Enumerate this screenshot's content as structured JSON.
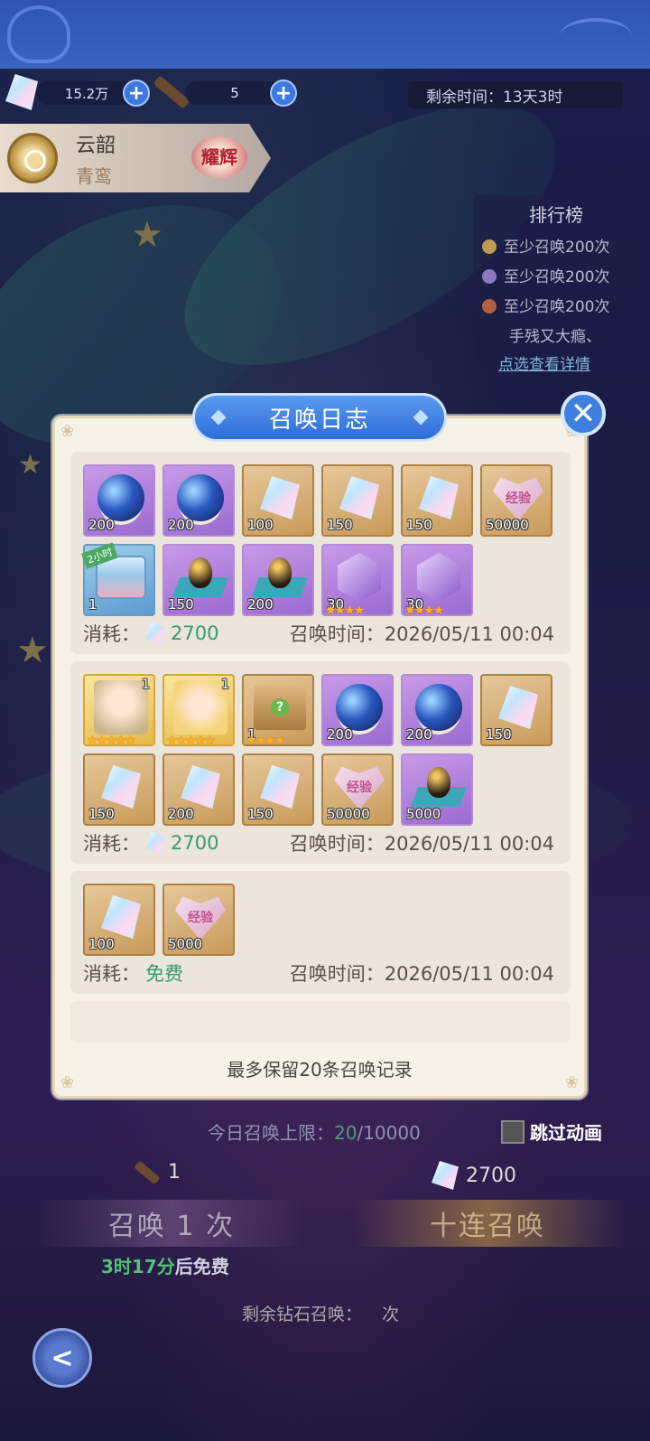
{
  "resources": {
    "crystal_amount": "15.2万",
    "scroll_amount": "5"
  },
  "event": {
    "remaining_time": "剩余时间：13天3时",
    "banner_name": "云韶",
    "banner_sub": "青鸾",
    "banner_badge": "耀辉"
  },
  "ranking": {
    "title": "排行榜",
    "entries": [
      "至少召唤200次",
      "至少召唤200次",
      "至少召唤200次"
    ],
    "tip": "手残又大瘾、",
    "link": "点选查看详情"
  },
  "modal": {
    "title": "召唤日志",
    "close": "✕",
    "note": "最多保留20条召唤记录",
    "cost_label": "消耗：",
    "time_label": "召唤时间：",
    "records": [
      {
        "cost": "2700",
        "time": "2026/05/11 00:04",
        "items": [
          {
            "type": "orb",
            "qty": "200"
          },
          {
            "type": "orb",
            "qty": "200"
          },
          {
            "type": "gem",
            "qty": "100"
          },
          {
            "type": "gem",
            "qty": "150"
          },
          {
            "type": "gem",
            "qty": "150"
          },
          {
            "type": "heart",
            "qty": "50000",
            "text": "经验"
          },
          {
            "type": "chest",
            "qty": "1",
            "tag": "2小时"
          },
          {
            "type": "egg",
            "qty": "150"
          },
          {
            "type": "egg",
            "qty": "200"
          },
          {
            "type": "shard",
            "qty": "30",
            "stars": "★★★★"
          },
          {
            "type": "shard",
            "qty": "30",
            "stars": "★★★★"
          }
        ]
      },
      {
        "cost": "2700",
        "time": "2026/05/11 00:04",
        "items": [
          {
            "type": "hero",
            "level": "1",
            "stars": "★★★★★"
          },
          {
            "type": "hero2",
            "level": "1",
            "stars": "★★★★★"
          },
          {
            "type": "box",
            "qty": "1",
            "stars": "★★★★",
            "mark": "?"
          },
          {
            "type": "orb",
            "qty": "200"
          },
          {
            "type": "orb",
            "qty": "200"
          },
          {
            "type": "gem",
            "qty": "150"
          },
          {
            "type": "gem",
            "qty": "150"
          },
          {
            "type": "gem",
            "qty": "200"
          },
          {
            "type": "gem",
            "qty": "150"
          },
          {
            "type": "heart",
            "qty": "50000",
            "text": "经验"
          },
          {
            "type": "egg",
            "qty": "5000"
          }
        ]
      },
      {
        "cost": "免费",
        "time": "2026/05/11 00:04",
        "items": [
          {
            "type": "gem",
            "qty": "100"
          },
          {
            "type": "heart",
            "qty": "5000",
            "text": "经验"
          }
        ]
      }
    ]
  },
  "summon": {
    "limit_label": "今日召唤上限：",
    "limit_value": "20",
    "limit_max": "/10000",
    "skip_anim": "跳过动画",
    "single_cost": "1",
    "ten_cost": "2700",
    "single_label": "召唤 1 次",
    "ten_label": "十连召唤",
    "free_time": "3时17分",
    "free_suffix": "后免费",
    "remain_prefix": "剩余钻石召唤：",
    "remain_suffix": "次"
  },
  "colors": {
    "accent_blue": "#3f7fe0",
    "modal_bg": "#f7f2e8",
    "free_green": "#3a9a6a"
  }
}
